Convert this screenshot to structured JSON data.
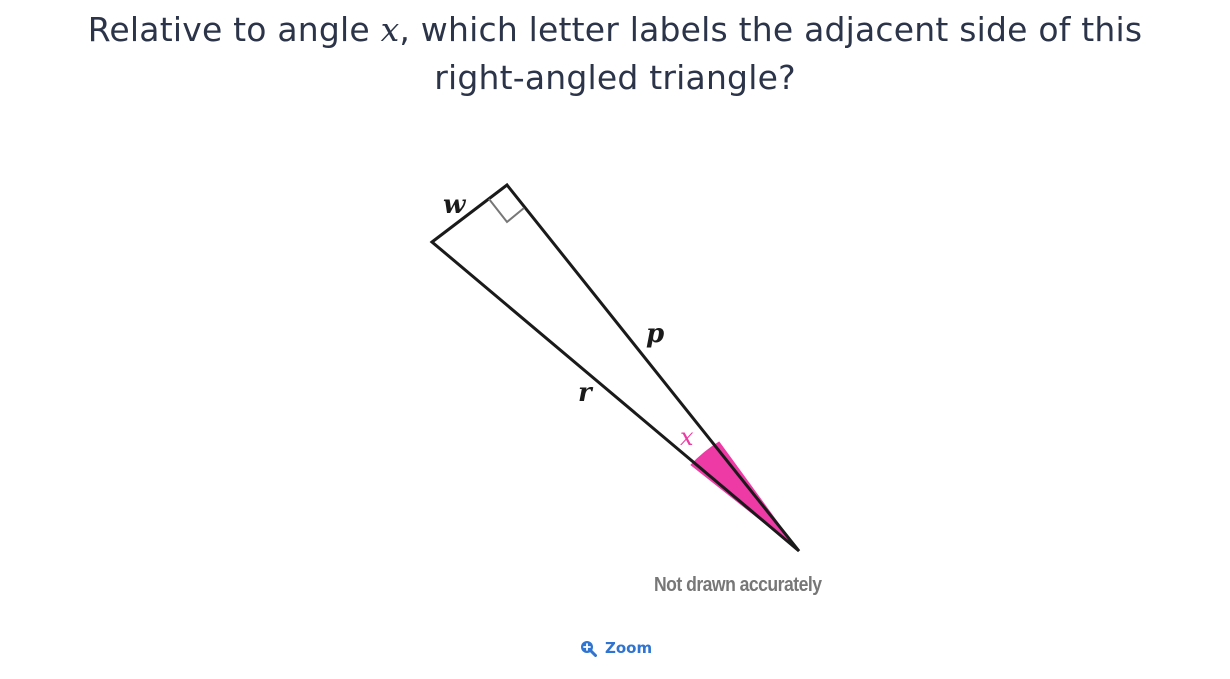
{
  "question": {
    "text_before": "Relative to angle ",
    "variable": "x",
    "text_line1_after": ", which letter labels the adjacent side of this",
    "text_line2": "right-angled triangle?"
  },
  "diagram": {
    "side_labels": {
      "w": "w",
      "p": "p",
      "r": "r"
    },
    "angle_label": "x",
    "angle_color": "#ee3aa4",
    "note": "Not drawn accurately"
  },
  "zoom": {
    "label": "Zoom",
    "icon": "zoom-in-icon",
    "color": "#2f74d0"
  }
}
